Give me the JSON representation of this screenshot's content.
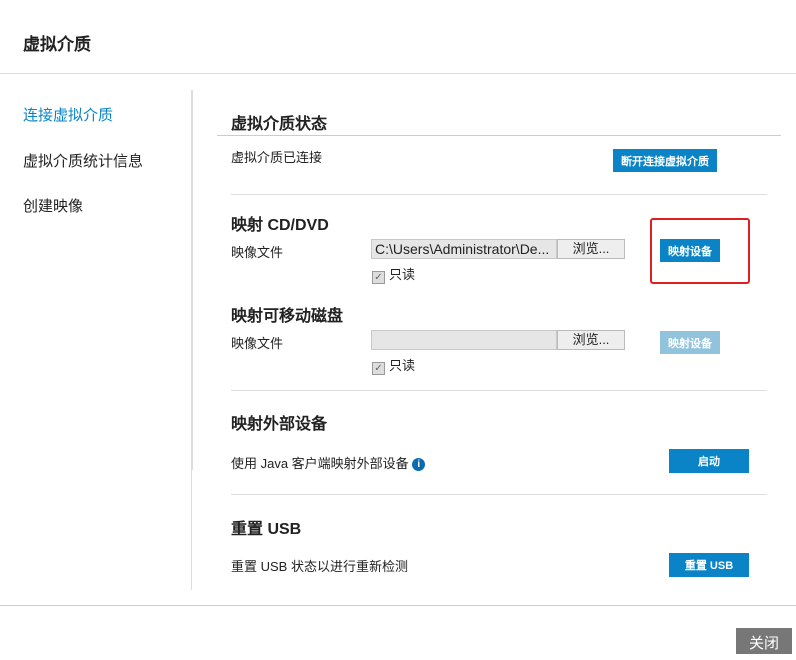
{
  "title": "虚拟介质",
  "sidebar": {
    "items": [
      {
        "label": "连接虚拟介质"
      },
      {
        "label": "虚拟介质统计信息"
      },
      {
        "label": "创建映像"
      }
    ]
  },
  "status": {
    "heading": "虚拟介质状态",
    "text": "虚拟介质已连接",
    "button": "断开连接虚拟介质"
  },
  "cd": {
    "heading": "映射 CD/DVD",
    "label": "映像文件",
    "value": "C:\\Users\\Administrator\\De...",
    "browse": "浏览...",
    "readonly": "只读",
    "button": "映射设备"
  },
  "removable": {
    "heading": "映射可移动磁盘",
    "label": "映像文件",
    "value": "",
    "browse": "浏览...",
    "readonly": "只读",
    "button": "映射设备"
  },
  "external": {
    "heading": "映射外部设备",
    "text": "使用 Java 客户端映射外部设备",
    "info": "i",
    "button": "启动"
  },
  "usb": {
    "heading": "重置 USB",
    "text": "重置 USB 状态以进行重新检测",
    "button": "重置 USB"
  },
  "footer": {
    "close": "关闭"
  }
}
